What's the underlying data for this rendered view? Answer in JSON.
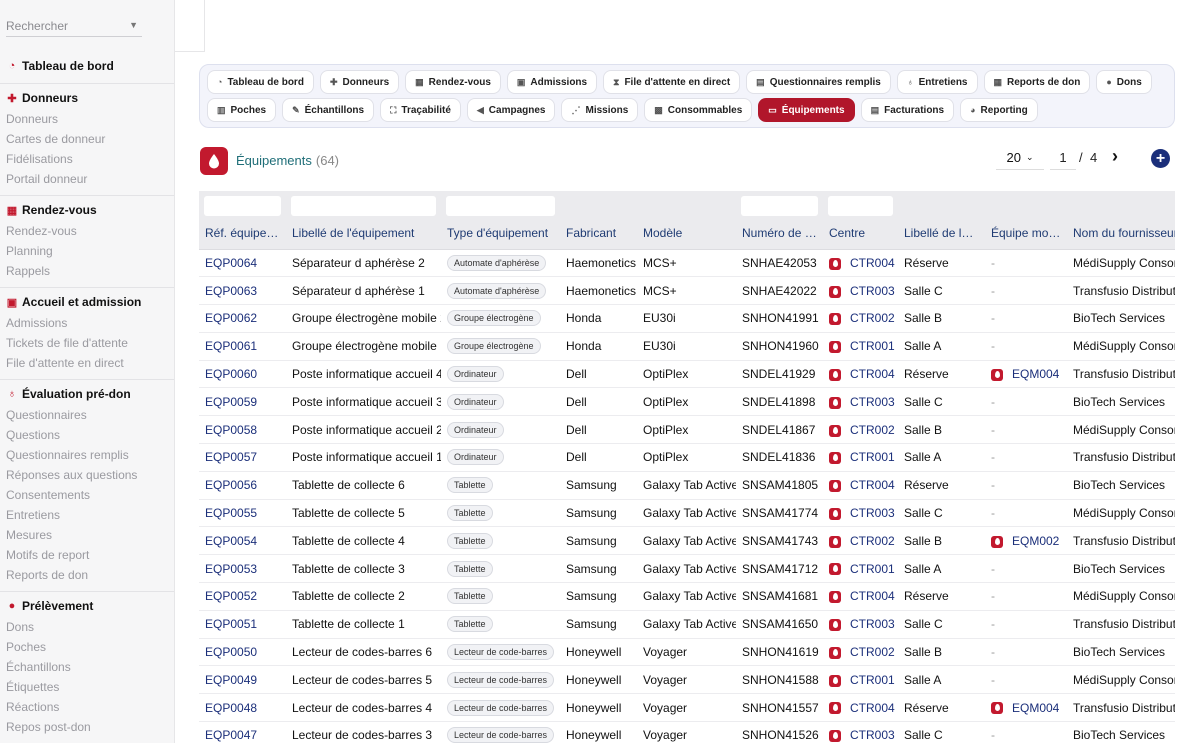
{
  "sidebar": {
    "search_placeholder": "Rechercher",
    "sections": [
      {
        "title": "Tableau de bord",
        "icon": "dashboard-icon",
        "items": []
      },
      {
        "title": "Donneurs",
        "icon": "add-user-icon",
        "items": [
          "Donneurs",
          "Cartes de donneur",
          "Fidélisations",
          "Portail donneur"
        ]
      },
      {
        "title": "Rendez-vous",
        "icon": "calendar-icon",
        "items": [
          "Rendez-vous",
          "Planning",
          "Rappels"
        ]
      },
      {
        "title": "Accueil et admission",
        "icon": "clipboard-icon",
        "items": [
          "Admissions",
          "Tickets de file d'attente",
          "File d'attente en direct"
        ]
      },
      {
        "title": "Évaluation pré-don",
        "icon": "stethoscope-icon",
        "items": [
          "Questionnaires",
          "Questions",
          "Questionnaires remplis",
          "Réponses aux questions",
          "Consentements",
          "Entretiens",
          "Mesures",
          "Motifs de report",
          "Reports de don"
        ]
      },
      {
        "title": "Prélèvement",
        "icon": "blood-drop-icon",
        "items": [
          "Dons",
          "Poches",
          "Échantillons",
          "Étiquettes",
          "Réactions",
          "Repos post-don"
        ]
      }
    ]
  },
  "tabs": {
    "row1": [
      {
        "label": "Tableau de bord",
        "icon": "dashboard-icon"
      },
      {
        "label": "Donneurs",
        "icon": "add-user-icon"
      },
      {
        "label": "Rendez-vous",
        "icon": "calendar-icon"
      },
      {
        "label": "Admissions",
        "icon": "clipboard-icon"
      },
      {
        "label": "File d'attente en direct",
        "icon": "hourglass-icon"
      },
      {
        "label": "Questionnaires remplis",
        "icon": "form-icon"
      },
      {
        "label": "Entretiens",
        "icon": "stethoscope-icon"
      },
      {
        "label": "Reports de don",
        "icon": "calendar-x-icon"
      },
      {
        "label": "Dons",
        "icon": "blood-drop-icon"
      }
    ],
    "row2": [
      {
        "label": "Poches",
        "icon": "bag-icon"
      },
      {
        "label": "Échantillons",
        "icon": "pipette-icon"
      },
      {
        "label": "Traçabilité",
        "icon": "network-icon"
      },
      {
        "label": "Campagnes",
        "icon": "megaphone-icon"
      },
      {
        "label": "Missions",
        "icon": "route-icon"
      },
      {
        "label": "Consommables",
        "icon": "boxes-icon"
      },
      {
        "label": "Équipements",
        "icon": "monitor-icon",
        "active": true
      },
      {
        "label": "Facturations",
        "icon": "invoice-icon"
      },
      {
        "label": "Reporting",
        "icon": "chart-pie-icon"
      }
    ]
  },
  "header": {
    "title": "Équipements",
    "count": "(64)"
  },
  "pagination": {
    "page_size": "20",
    "page": "1",
    "separator": "/",
    "total_pages": "4"
  },
  "colors": {
    "accent": "#b1162b",
    "link": "#1b2f7a",
    "title": "#1f6e78"
  },
  "table": {
    "columns": [
      "Réf. équipe…",
      "Libellé de l'équipement",
      "Type d'équipement",
      "Fabricant",
      "Modèle",
      "Numéro de s…",
      "Centre",
      "Libellé de la …",
      "Équipe mobile",
      "Nom du fournisseur"
    ],
    "rows": [
      [
        "EQP0064",
        "Séparateur d aphérèse 2",
        "Automate d'aphérèse",
        "Haemonetics",
        "MCS+",
        "SNHAE42053",
        "CTR004",
        "Réserve",
        "-",
        "MédiSupply Consom"
      ],
      [
        "EQP0063",
        "Séparateur d aphérèse 1",
        "Automate d'aphérèse",
        "Haemonetics",
        "MCS+",
        "SNHAE42022",
        "CTR003",
        "Salle C",
        "-",
        "Transfusio Distributio"
      ],
      [
        "EQP0062",
        "Groupe électrogène mobile 2",
        "Groupe électrogène",
        "Honda",
        "EU30i",
        "SNHON41991",
        "CTR002",
        "Salle B",
        "-",
        "BioTech Services"
      ],
      [
        "EQP0061",
        "Groupe électrogène mobile 1",
        "Groupe électrogène",
        "Honda",
        "EU30i",
        "SNHON41960",
        "CTR001",
        "Salle A",
        "-",
        "MédiSupply Consom"
      ],
      [
        "EQP0060",
        "Poste informatique accueil 4",
        "Ordinateur",
        "Dell",
        "OptiPlex",
        "SNDEL41929",
        "CTR004",
        "Réserve",
        "EQM004",
        "Transfusio Distributio"
      ],
      [
        "EQP0059",
        "Poste informatique accueil 3",
        "Ordinateur",
        "Dell",
        "OptiPlex",
        "SNDEL41898",
        "CTR003",
        "Salle C",
        "-",
        "BioTech Services"
      ],
      [
        "EQP0058",
        "Poste informatique accueil 2",
        "Ordinateur",
        "Dell",
        "OptiPlex",
        "SNDEL41867",
        "CTR002",
        "Salle B",
        "-",
        "MédiSupply Consom"
      ],
      [
        "EQP0057",
        "Poste informatique accueil 1",
        "Ordinateur",
        "Dell",
        "OptiPlex",
        "SNDEL41836",
        "CTR001",
        "Salle A",
        "-",
        "Transfusio Distributio"
      ],
      [
        "EQP0056",
        "Tablette de collecte 6",
        "Tablette",
        "Samsung",
        "Galaxy Tab Active",
        "SNSAM41805",
        "CTR004",
        "Réserve",
        "-",
        "BioTech Services"
      ],
      [
        "EQP0055",
        "Tablette de collecte 5",
        "Tablette",
        "Samsung",
        "Galaxy Tab Active",
        "SNSAM41774",
        "CTR003",
        "Salle C",
        "-",
        "MédiSupply Consom"
      ],
      [
        "EQP0054",
        "Tablette de collecte 4",
        "Tablette",
        "Samsung",
        "Galaxy Tab Active",
        "SNSAM41743",
        "CTR002",
        "Salle B",
        "EQM002",
        "Transfusio Distributio"
      ],
      [
        "EQP0053",
        "Tablette de collecte 3",
        "Tablette",
        "Samsung",
        "Galaxy Tab Active",
        "SNSAM41712",
        "CTR001",
        "Salle A",
        "-",
        "BioTech Services"
      ],
      [
        "EQP0052",
        "Tablette de collecte 2",
        "Tablette",
        "Samsung",
        "Galaxy Tab Active",
        "SNSAM41681",
        "CTR004",
        "Réserve",
        "-",
        "MédiSupply Consom"
      ],
      [
        "EQP0051",
        "Tablette de collecte 1",
        "Tablette",
        "Samsung",
        "Galaxy Tab Active",
        "SNSAM41650",
        "CTR003",
        "Salle C",
        "-",
        "Transfusio Distributio"
      ],
      [
        "EQP0050",
        "Lecteur de codes-barres 6",
        "Lecteur de code-barres",
        "Honeywell",
        "Voyager",
        "SNHON41619",
        "CTR002",
        "Salle B",
        "-",
        "BioTech Services"
      ],
      [
        "EQP0049",
        "Lecteur de codes-barres 5",
        "Lecteur de code-barres",
        "Honeywell",
        "Voyager",
        "SNHON41588",
        "CTR001",
        "Salle A",
        "-",
        "MédiSupply Consom"
      ],
      [
        "EQP0048",
        "Lecteur de codes-barres 4",
        "Lecteur de code-barres",
        "Honeywell",
        "Voyager",
        "SNHON41557",
        "CTR004",
        "Réserve",
        "EQM004",
        "Transfusio Distributio"
      ],
      [
        "EQP0047",
        "Lecteur de codes-barres 3",
        "Lecteur de code-barres",
        "Honeywell",
        "Voyager",
        "SNHON41526",
        "CTR003",
        "Salle C",
        "-",
        "BioTech Services"
      ]
    ]
  }
}
